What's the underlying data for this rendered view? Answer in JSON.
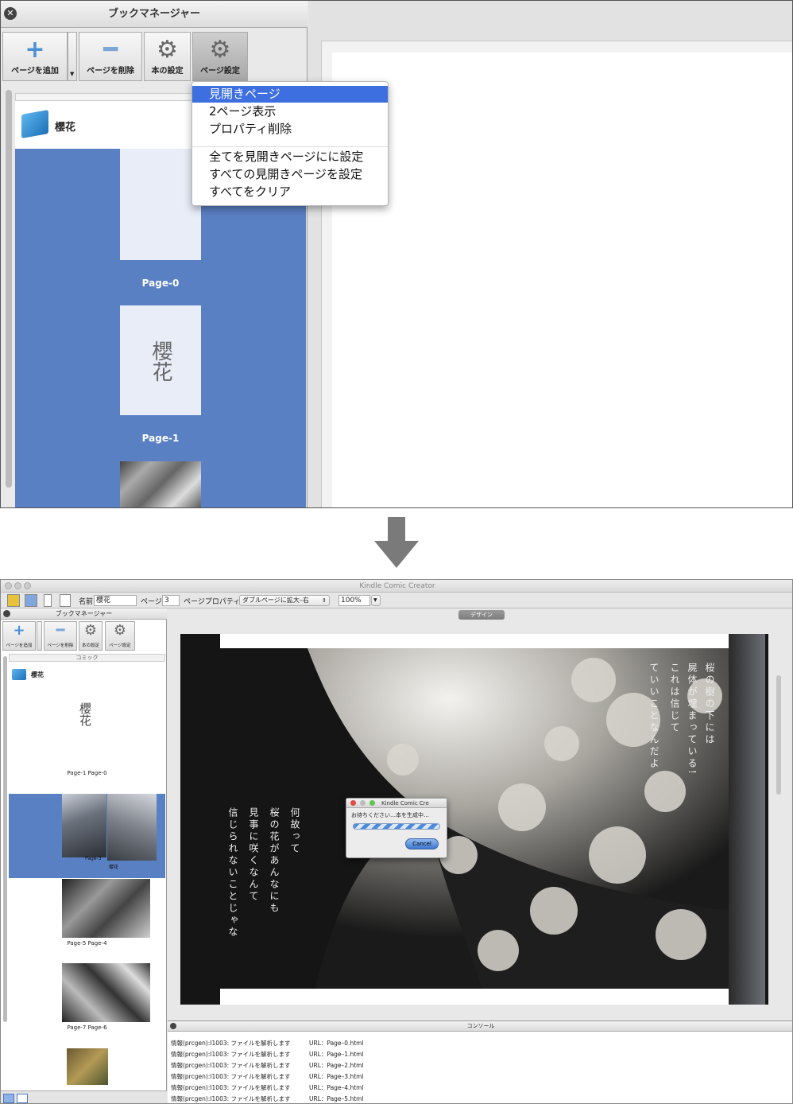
{
  "top": {
    "panel_title": "ブックマネージャー",
    "toolbar": {
      "add_page": "ページを追加",
      "delete_page": "ページを削除",
      "book_settings": "本の設定",
      "page_settings": "ページ設定"
    },
    "book_name": "櫻花",
    "pages": [
      {
        "label": "Page-0"
      },
      {
        "label": "Page-1",
        "thumb_text": "櫻花"
      }
    ],
    "menu": {
      "items": [
        "見開きページ",
        "2ページ表示",
        "プロパティ削除"
      ],
      "items2": [
        "全てを見開きページにに設定",
        "すべての見開きページを設定",
        "すべてをクリア"
      ],
      "selected": "見開きページ"
    }
  },
  "bottom": {
    "window_title": "Kindle Comic Creator",
    "toolbar": {
      "name_label": "名前",
      "name_value": "櫻花",
      "page_label": "ページ",
      "page_value": "3",
      "page_property_label": "ページプロパティ",
      "page_property_value": "ダブルページに拡大–右",
      "zoom_value": "100%"
    },
    "book_manager": {
      "title": "ブックマネージャー",
      "add_page": "ページを追加",
      "delete_page": "ページを削除",
      "book_settings": "本の設定",
      "page_settings": "ページ設定",
      "section_label": "コミック",
      "book_name": "櫻花",
      "thumb_title": "櫻花",
      "spreads": [
        {
          "label": "Page-1  Page-0"
        },
        {
          "label": "Page-3",
          "sub": "櫻花"
        },
        {
          "label": "Page-5  Page-4"
        },
        {
          "label": "Page-7  Page-6"
        }
      ]
    },
    "design_tab": "デザイン",
    "poem": {
      "right_col1": "桜の樹の下には",
      "right_col2": "屍体が埋まっている!",
      "right_col3": "これは信じて",
      "right_col4": "ていいことなんだよ",
      "left_col1": "何故って",
      "left_col2": "桜の花があんなにも",
      "left_col3": "見事に咲くなんて",
      "left_col4": "信じられないことじゃな"
    },
    "dialog": {
      "title": "Kindle Comic Cre",
      "message": "お待ちください…本を生成中…",
      "cancel": "Cancel"
    },
    "console": {
      "title": "コンソール",
      "lines": [
        {
          "msg": "情報(prcgen):I1003: ファイルを解析します",
          "url": "URL：Page–0.html"
        },
        {
          "msg": "情報(prcgen):I1003: ファイルを解析します",
          "url": "URL：Page–1.html"
        },
        {
          "msg": "情報(prcgen):I1003: ファイルを解析します",
          "url": "URL：Page–2.html"
        },
        {
          "msg": "情報(prcgen):I1003: ファイルを解析します",
          "url": "URL：Page–3.html"
        },
        {
          "msg": "情報(prcgen):I1003: ファイルを解析します",
          "url": "URL：Page–4.html"
        },
        {
          "msg": "情報(prcgen):I1003: ファイルを解析します",
          "url": "URL：Page–5.html"
        }
      ]
    }
  },
  "colors": {
    "selection_blue": "#5a80c4",
    "menu_highlight": "#3d6fe0"
  }
}
